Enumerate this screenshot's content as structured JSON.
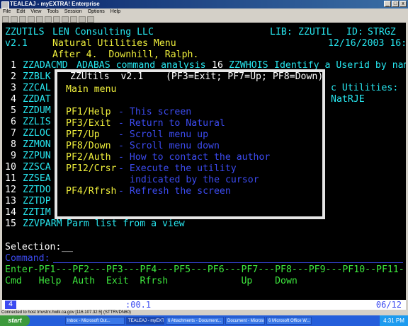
{
  "window": {
    "title": "TEALEAJ - myEXTRA! Enterprise",
    "buttons": [
      "_",
      "□",
      "x"
    ]
  },
  "menubar": [
    "File",
    "Edit",
    "View",
    "Tools",
    "Session",
    "Options",
    "Help"
  ],
  "screen": {
    "header": {
      "app_id": "ZZUTILS",
      "company": "LEN Consulting LLC",
      "lib_label": "LIB:",
      "lib_value": "ZZUTIL",
      "id_label": "ID:",
      "id_value": "STRGZ",
      "version": "v2.1",
      "subtitle": "Natural Utilities Menu",
      "date_time": "12/16/2003 16:31",
      "after_line": "After 4.  Downhill, Ralph."
    },
    "menu_items": [
      {
        "num": " 1",
        "code": "ZZADACMD",
        "desc": "ADABAS command analysis"
      },
      {
        "num": " 2",
        "code": "ZZBLK"
      },
      {
        "num": " 3",
        "code": "ZZCAL"
      },
      {
        "num": " 4",
        "code": "ZZDAT"
      },
      {
        "num": " 5",
        "code": "ZZDUM"
      },
      {
        "num": " 6",
        "code": "ZZLIS"
      },
      {
        "num": " 7",
        "code": "ZZLOC"
      },
      {
        "num": " 8",
        "code": "ZZMON"
      },
      {
        "num": " 9",
        "code": "ZZPUN"
      },
      {
        "num": "10",
        "code": "ZZSCA"
      },
      {
        "num": "11",
        "code": "ZZSEA"
      },
      {
        "num": "12",
        "code": "ZZTDO"
      },
      {
        "num": "13",
        "code": "ZZTDP"
      },
      {
        "num": "14",
        "code": "ZZTIM"
      },
      {
        "num": "15",
        "code": "ZZVPARM",
        "desc": "Parm list from a view"
      }
    ],
    "right_item": {
      "num": "16",
      "code": "ZZWHOIS",
      "desc": "Identify a Userid by name"
    },
    "right_fragment_1": "c Utilities:",
    "right_fragment_2": "NatRJE",
    "popup": {
      "title": "ZZUtils  v2.1    (PF3=Exit; PF7=Up; PF8=Down)",
      "heading": "Main menu",
      "rows": [
        {
          "key": "PF1/Help",
          "desc": "- This screen"
        },
        {
          "key": "PF3/Exit",
          "desc": "- Return to Natural"
        },
        {
          "key": "PF7/Up",
          "desc": "- Scroll menu up"
        },
        {
          "key": "PF8/Down",
          "desc": "- Scroll menu down"
        },
        {
          "key": "PF2/Auth",
          "desc": "- How to contact the author"
        },
        {
          "key": "PF12/Crsr",
          "desc": "- Execute the utility"
        },
        {
          "key": "",
          "desc": "indicated by the cursor"
        },
        {
          "key": "PF4/Rfrsh",
          "desc": "- Refresh the screen"
        }
      ]
    },
    "selection_label": "Selection:",
    "selection_value": "__",
    "command_label": "Command:",
    "pf_line": "Enter-PF1---PF2---PF3---PF4---PF5---PF6---PF7---PF8---PF9---PF10--PF11--PF12---",
    "pf_labels": "Cmd   Help  Auth  Exit  Rfrsh             Up    Down                    Crsr",
    "status_left": "4",
    "status_mid": ":00.1",
    "status_right": "06/12"
  },
  "connection_text": "Connected to host tmvstrx.hwlk.ca.gov [116.107.32.5] (STTRVDN60)",
  "taskbar": {
    "start": "start",
    "tasks": [
      "Inbox - Microsoft Out...",
      "TEALEAJ - myEXT...",
      "6 Attachments - Document...",
      "Document - Microsoft...",
      "6 Microsoft Office W..."
    ],
    "clock": "4:31 PM"
  }
}
